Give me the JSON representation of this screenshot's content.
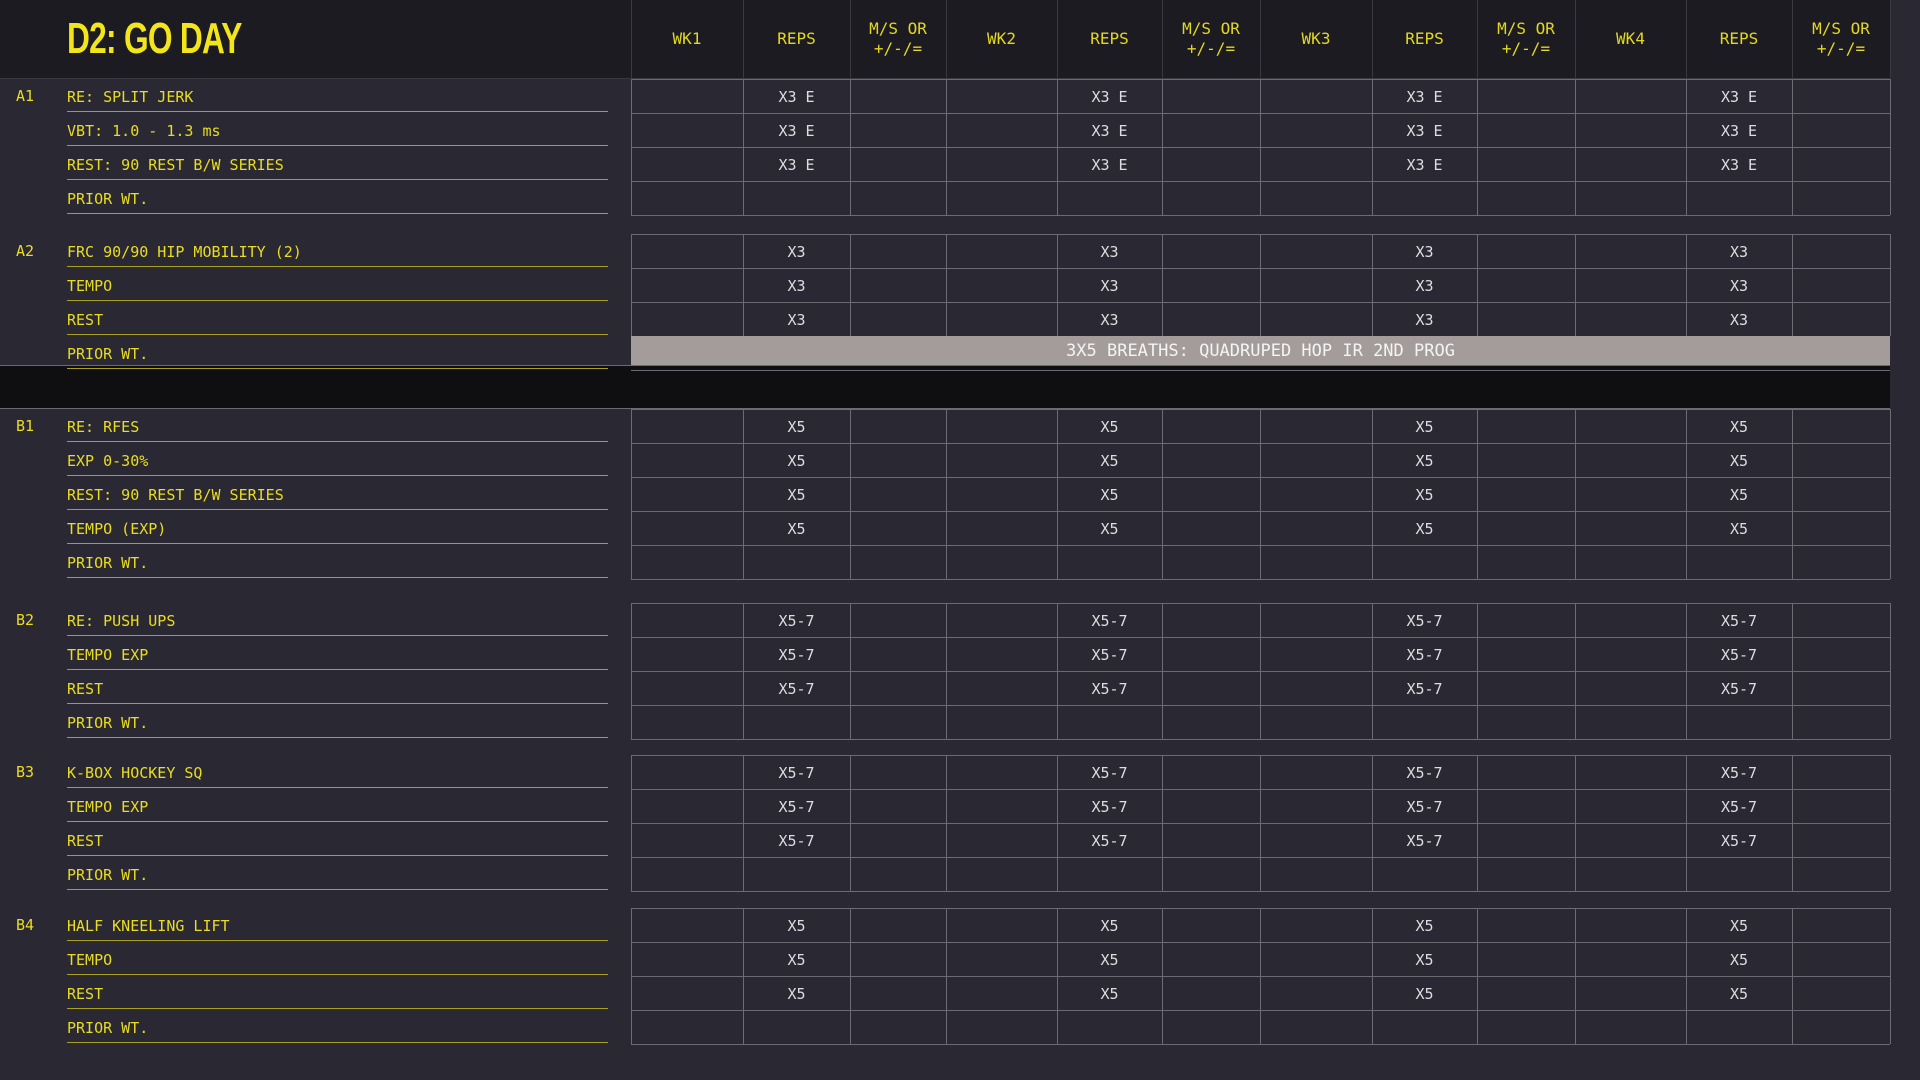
{
  "title": "D2: GO DAY",
  "headers": [
    "WK1",
    "REPS",
    "M/S OR\n+/-/=",
    "WK2",
    "REPS",
    "M/S OR\n+/-/=",
    "WK3",
    "REPS",
    "M/S OR\n+/-/=",
    "WK4",
    "REPS",
    "M/S OR\n+/-/="
  ],
  "sections": [
    {
      "id": "A1",
      "rows": [
        {
          "label": "RE: SPLIT JERK",
          "reps": "X3 E"
        },
        {
          "label": "VBT: 1.0 - 1.3 ms",
          "reps": "X3 E"
        },
        {
          "label": "REST: 90 REST B/W SERIES",
          "reps": "X3 E"
        },
        {
          "label": "PRIOR WT.",
          "reps": ""
        }
      ]
    },
    {
      "id": "A2",
      "rows": [
        {
          "label": "FRC 90/90 HIP MOBILITY (2)",
          "reps": "X3"
        },
        {
          "label": "TEMPO",
          "reps": "X3"
        },
        {
          "label": "REST",
          "reps": "X3"
        },
        {
          "label": "PRIOR WT.",
          "reps": ""
        }
      ]
    },
    {
      "id": "B1",
      "rows": [
        {
          "label": "RE: RFES",
          "reps": "X5"
        },
        {
          "label": "EXP 0-30%",
          "reps": "X5"
        },
        {
          "label": "REST: 90 REST B/W SERIES",
          "reps": "X5"
        },
        {
          "label": "TEMPO (EXP)",
          "reps": "X5"
        },
        {
          "label": "PRIOR WT.",
          "reps": ""
        }
      ]
    },
    {
      "id": "B2",
      "rows": [
        {
          "label": "RE: PUSH UPS",
          "reps": "X5-7"
        },
        {
          "label": "TEMPO EXP",
          "reps": "X5-7"
        },
        {
          "label": "REST",
          "reps": "X5-7"
        },
        {
          "label": "PRIOR WT.",
          "reps": ""
        }
      ]
    },
    {
      "id": "B3",
      "rows": [
        {
          "label": "K-BOX HOCKEY SQ",
          "reps": "X5-7"
        },
        {
          "label": "TEMPO EXP",
          "reps": "X5-7"
        },
        {
          "label": "REST",
          "reps": "X5-7"
        },
        {
          "label": "PRIOR WT.",
          "reps": ""
        }
      ]
    },
    {
      "id": "B4",
      "rows": [
        {
          "label": "HALF KNEELING LIFT",
          "reps": "X5"
        },
        {
          "label": "TEMPO",
          "reps": "X5"
        },
        {
          "label": "REST",
          "reps": "X5"
        },
        {
          "label": "PRIOR WT.",
          "reps": ""
        }
      ]
    }
  ],
  "banner_text": "3X5 BREATHS: QUADRUPED HOP IR 2ND PROG",
  "colors": {
    "accent": "#e9dc21",
    "background": "#2a2933",
    "banner": "#a39c9a"
  }
}
